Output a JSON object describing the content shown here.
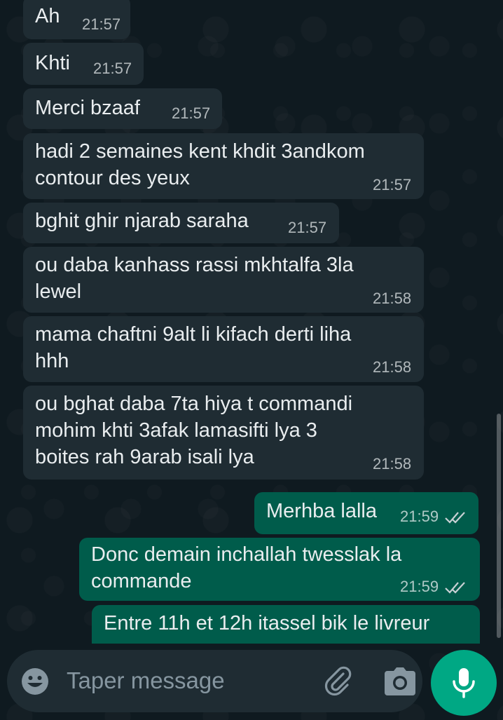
{
  "chat": {
    "messages": [
      {
        "text": "Ah",
        "time": "21:57",
        "direction": "in"
      },
      {
        "text": "Khti",
        "time": "21:57",
        "direction": "in"
      },
      {
        "text": "Merci bzaaf",
        "time": "21:57",
        "direction": "in"
      },
      {
        "text": "hadi 2 semaines kent khdit 3andkom\ncontour des yeux",
        "time": "21:57",
        "direction": "in"
      },
      {
        "text": "bghit ghir njarab saraha",
        "time": "21:57",
        "direction": "in"
      },
      {
        "text": "ou daba kanhass rassi mkhtalfa 3la\nlewel",
        "time": "21:58",
        "direction": "in"
      },
      {
        "text": "mama chaftni 9alt li kifach derti liha\nhhh",
        "time": "21:58",
        "direction": "in"
      },
      {
        "text": "ou bghat daba 7ta hiya t commandi\nmohim khti 3afak lamasifti lya 3\nboites rah 9arab isali lya",
        "time": "21:58",
        "direction": "in"
      },
      {
        "text": "Merhba lalla",
        "time": "21:59",
        "direction": "out",
        "status": "read-ticks"
      },
      {
        "text": "Donc demain inchallah twesslak la\ncommande",
        "time": "21:59",
        "direction": "out",
        "status": "read-ticks"
      },
      {
        "text": "Entre 11h et 12h itassel bik le livreur",
        "time": "",
        "direction": "out"
      }
    ]
  },
  "composer": {
    "placeholder": "Taper message",
    "icons": [
      "emoji-icon",
      "attach-icon",
      "camera-icon",
      "mic-icon"
    ]
  },
  "colors": {
    "incoming_bubble": "#1f2c33",
    "outgoing_bubble": "#005c4b",
    "background": "#0b141a",
    "accent": "#00a884",
    "text": "#e9edef",
    "placeholder": "#8696a0"
  }
}
